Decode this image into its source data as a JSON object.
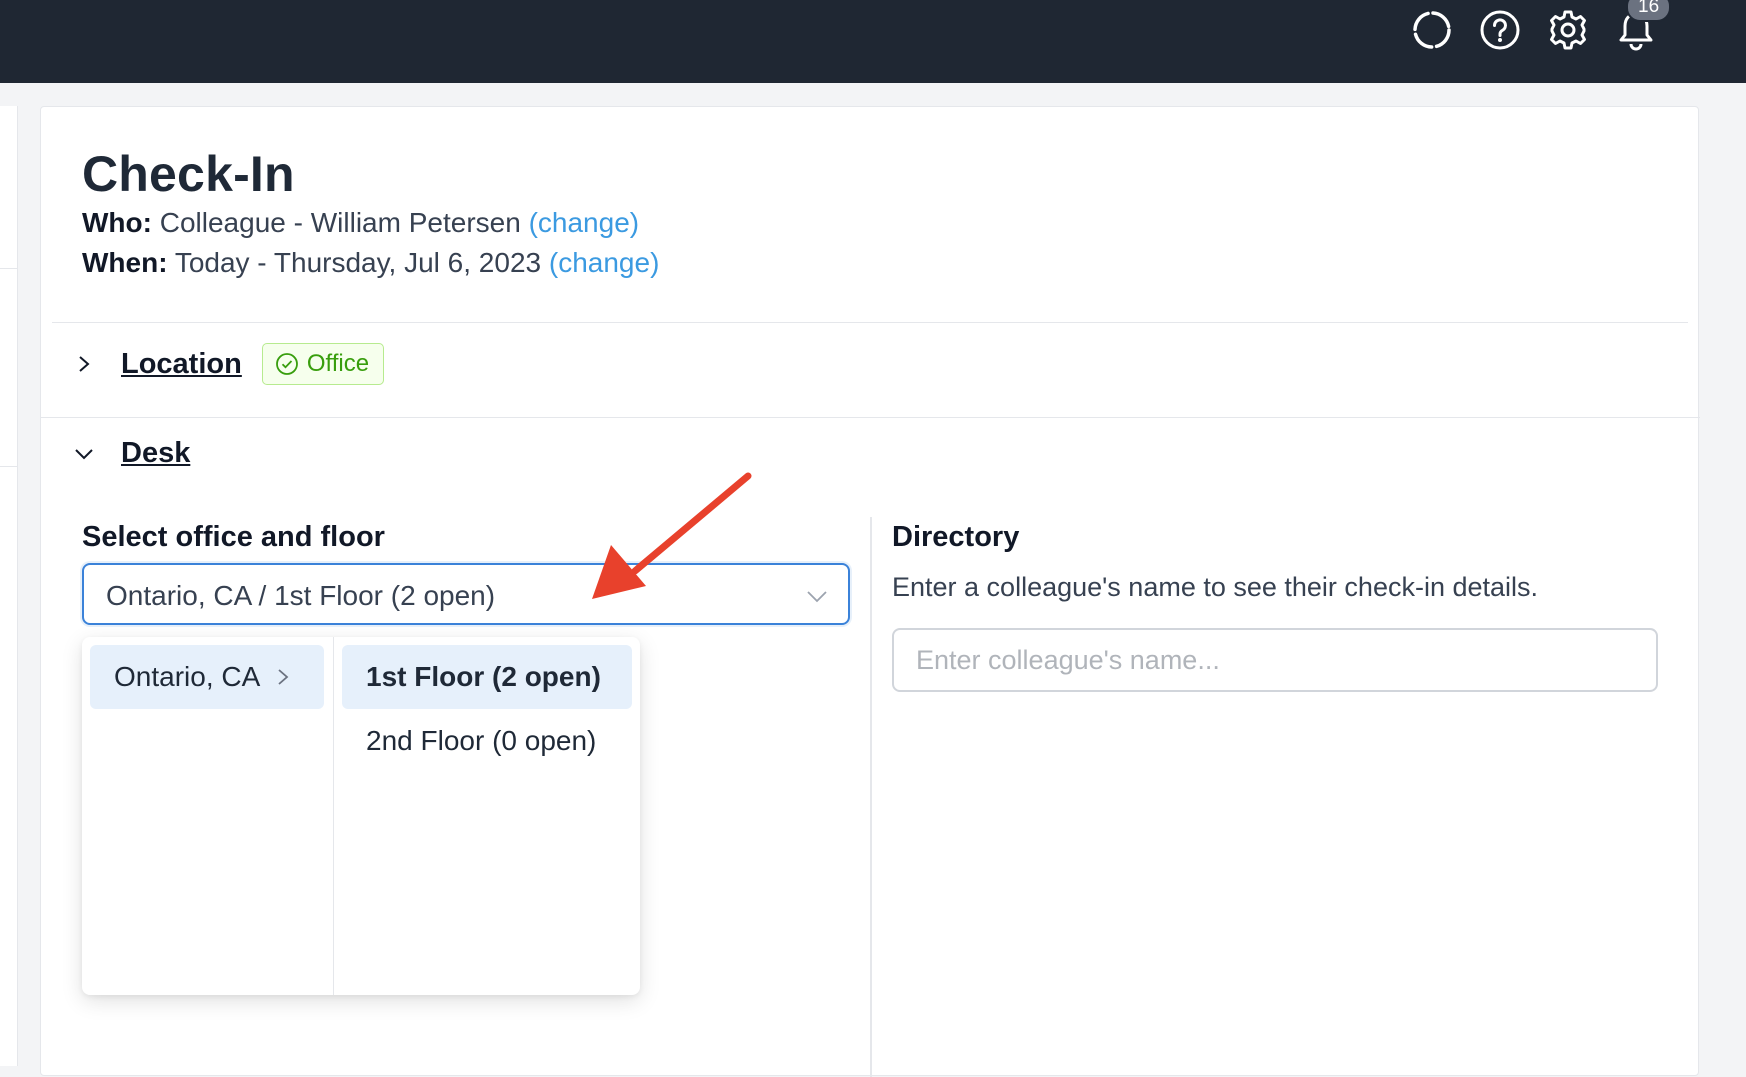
{
  "topbar": {
    "icons": [
      "loading-icon",
      "help-icon",
      "settings-icon",
      "bell-icon"
    ],
    "notifications_count": "16"
  },
  "page": {
    "title": "Check-In",
    "who_label": "Who:",
    "who_value": "Colleague - William Petersen",
    "when_label": "When:",
    "when_value": "Today - Thursday, Jul 6, 2023",
    "change_link": "(change)"
  },
  "location": {
    "title": "Location",
    "tag": "Office"
  },
  "desk": {
    "title": "Desk",
    "select_label": "Select office and floor",
    "select_value": "Ontario, CA / 1st Floor (2 open)",
    "dropdown": {
      "offices": [
        "Ontario, CA"
      ],
      "floors": [
        "1st Floor (2 open)",
        "2nd Floor (0 open)"
      ]
    }
  },
  "directory": {
    "title": "Directory",
    "description": "Enter a colleague's name to see their check-in details.",
    "placeholder": "Enter colleague's name..."
  },
  "colors": {
    "topbar": "#1f2733",
    "link": "#3b9ae1",
    "tag_green": "#389e0d",
    "annotation_arrow": "#e8412c",
    "active_option": "#e6f0fb"
  }
}
